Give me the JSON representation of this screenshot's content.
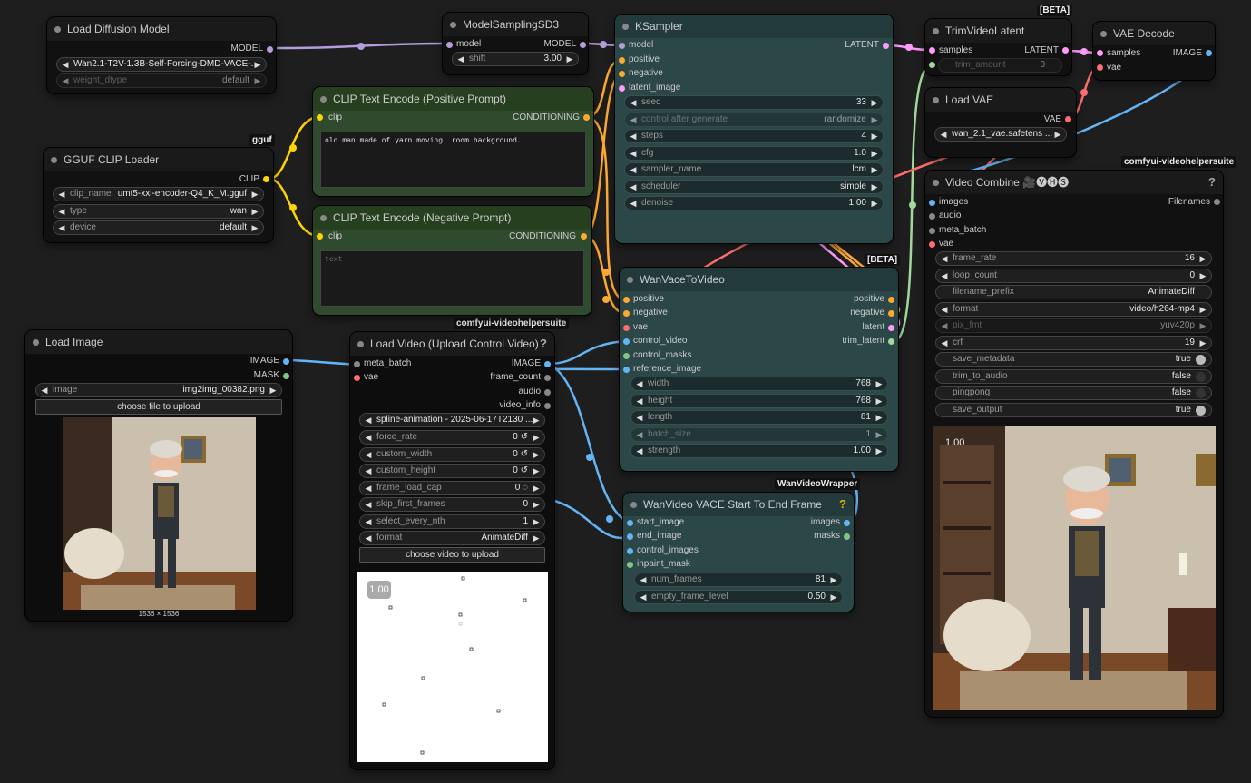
{
  "tags": {
    "gguf": "gguf",
    "beta1": "[BETA]",
    "beta2": "[BETA]",
    "vhs1": "comfyui-videohelpersuite",
    "vhs2": "comfyui-videohelpersuite",
    "wrapper": "WanVideoWrapper"
  },
  "colors": {
    "model": "#b39ddb",
    "clip": "#ffd500",
    "cond": "#ffa931",
    "latent": "#ff9cf9",
    "vae": "#ff6e6e",
    "image": "#64b5f6",
    "mask": "#81c784",
    "trim": "#a1d99b"
  },
  "load_diffusion": {
    "title": "Load Diffusion Model",
    "out": "MODEL",
    "unet": "Wan2.1-T2V-1.3B-Self-Forcing-DMD-VACE-...",
    "dtype_label": "weight_dtype",
    "dtype": "default"
  },
  "model_sampling": {
    "title": "ModelSamplingSD3",
    "in": "model",
    "out": "MODEL",
    "shift_label": "shift",
    "shift": "3.00"
  },
  "ksampler": {
    "title": "KSampler",
    "inputs": [
      "model",
      "positive",
      "negative",
      "latent_image"
    ],
    "out": "LATENT",
    "widgets": [
      [
        "seed",
        "33"
      ],
      [
        "control after generate",
        "randomize"
      ],
      [
        "steps",
        "4"
      ],
      [
        "cfg",
        "1.0"
      ],
      [
        "sampler_name",
        "lcm"
      ],
      [
        "scheduler",
        "simple"
      ],
      [
        "denoise",
        "1.00"
      ]
    ]
  },
  "trim": {
    "title": "TrimVideoLatent",
    "in": "samples",
    "out": "LATENT",
    "amount_label": "trim_amount",
    "amount": "0"
  },
  "vae_decode": {
    "title": "VAE Decode",
    "in1": "samples",
    "in2": "vae",
    "out": "IMAGE"
  },
  "load_vae": {
    "title": "Load VAE",
    "out": "VAE",
    "vae": "wan_2.1_vae.safetens ..."
  },
  "clip_pos": {
    "title": "CLIP Text Encode (Positive Prompt)",
    "in": "clip",
    "out": "CONDITIONING",
    "text": "old man made of yarn moving. room background."
  },
  "clip_neg": {
    "title": "CLIP Text Encode (Negative Prompt)",
    "in": "clip",
    "out": "CONDITIONING",
    "placeholder": "text"
  },
  "gguf_clip": {
    "title": "GGUF CLIP Loader",
    "out": "CLIP",
    "widgets": [
      [
        "clip_name",
        "umt5-xxl-encoder-Q4_K_M.gguf"
      ],
      [
        "type",
        "wan"
      ],
      [
        "device",
        "default"
      ]
    ]
  },
  "wanvace": {
    "title": "WanVaceToVideo",
    "inputs": [
      "positive",
      "negative",
      "vae",
      "control_video",
      "control_masks",
      "reference_image"
    ],
    "outputs": [
      "positive",
      "negative",
      "latent",
      "trim_latent"
    ],
    "widgets": [
      [
        "width",
        "768"
      ],
      [
        "height",
        "768"
      ],
      [
        "length",
        "81"
      ],
      [
        "batch_size",
        "1"
      ],
      [
        "strength",
        "1.00"
      ]
    ]
  },
  "video_combine": {
    "title": "Video Combine 🎥🅥🅗🅢",
    "inputs": [
      "images",
      "audio",
      "meta_batch",
      "vae"
    ],
    "out": "Filenames",
    "widgets": [
      [
        "frame_rate",
        "16"
      ],
      [
        "loop_count",
        "0"
      ],
      [
        "filename_prefix",
        "AnimateDiff"
      ],
      [
        "format",
        "video/h264-mp4"
      ],
      [
        "pix_fmt",
        "yuv420p"
      ],
      [
        "crf",
        "19"
      ]
    ],
    "toggles": [
      [
        "save_metadata",
        "true"
      ],
      [
        "trim_to_audio",
        "false"
      ],
      [
        "pingpong",
        "false"
      ],
      [
        "save_output",
        "true"
      ]
    ],
    "badge": "1.00"
  },
  "load_image": {
    "title": "Load Image",
    "outputs": [
      "IMAGE",
      "MASK"
    ],
    "image_label": "image",
    "image": "img2img_00382.png",
    "upload": "choose file to upload",
    "dims": "1536 × 1536"
  },
  "load_video": {
    "title": "Load Video (Upload Control Video)",
    "inputs": [
      "meta_batch",
      "vae"
    ],
    "outputs": [
      "IMAGE",
      "frame_count",
      "audio",
      "video_info"
    ],
    "file": "spline-animation - 2025-06-17T2130 ...",
    "widgets": [
      [
        "force_rate",
        "0 ↺"
      ],
      [
        "custom_width",
        "0 ↺"
      ],
      [
        "custom_height",
        "0 ↺"
      ],
      [
        "frame_load_cap",
        "0 ◌"
      ],
      [
        "skip_first_frames",
        "0"
      ],
      [
        "select_every_nth",
        "1"
      ],
      [
        "format",
        "AnimateDiff"
      ]
    ],
    "upload": "choose video to upload",
    "badge": "1.00"
  },
  "vace_se": {
    "title": "WanVideo VACE Start To End Frame",
    "inputs": [
      "start_image",
      "end_image",
      "control_images",
      "inpaint_mask"
    ],
    "outputs": [
      "images",
      "masks"
    ],
    "widgets": [
      [
        "num_frames",
        "81"
      ],
      [
        "empty_frame_level",
        "0.50"
      ]
    ]
  }
}
